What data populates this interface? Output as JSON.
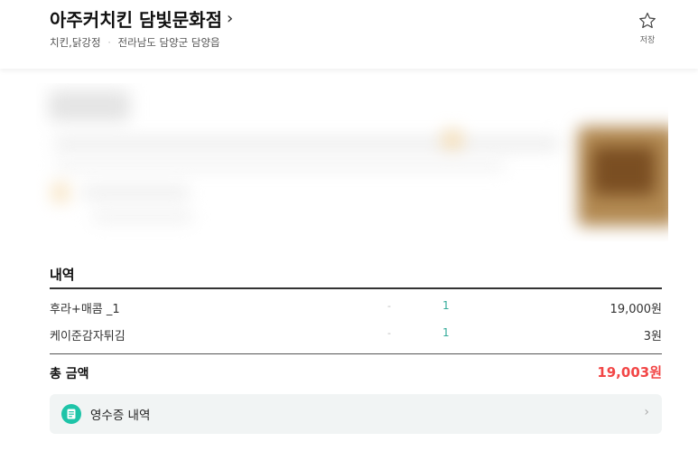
{
  "header": {
    "store_name": "아주커치킨 담빛문화점",
    "category": "치킨,닭강정",
    "address": "전라남도 담양군 담양읍",
    "save_label": "저장"
  },
  "order": {
    "section_title": "내역",
    "items": [
      {
        "name": "후라+매콤 _1",
        "dash": "-",
        "qty": "1",
        "price": "19,000원"
      },
      {
        "name": "케이준감자튀김",
        "dash": "-",
        "qty": "1",
        "price": "3원"
      }
    ],
    "total_label": "총 금액",
    "total_value": "19,003원"
  },
  "receipt": {
    "label": "영수증 내역"
  },
  "colors": {
    "accent_total": "#f24646",
    "receipt_icon": "#1ec4a8",
    "qty_text": "#33aa99"
  }
}
